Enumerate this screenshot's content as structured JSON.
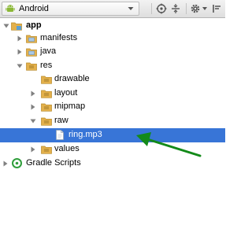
{
  "toolbar": {
    "view_selector": {
      "label": "Android",
      "icon": "android-icon",
      "dropdown_icon": "chevron-down-icon"
    },
    "icons": [
      "sync-target-icon",
      "collapse-all-icon",
      "gear-icon",
      "chevron-down-icon",
      "hide-panel-icon"
    ]
  },
  "tree": {
    "app": "app",
    "manifests": "manifests",
    "java": "java",
    "res": "res",
    "drawable": "drawable",
    "layout": "layout",
    "mipmap": "mipmap",
    "raw": "raw",
    "ring": "ring.mp3",
    "values": "values",
    "gradle": "Gradle Scripts"
  },
  "colors": {
    "selection": "#3875d7",
    "folder": "#e3b04b",
    "annotation_arrow": "#138a19"
  }
}
